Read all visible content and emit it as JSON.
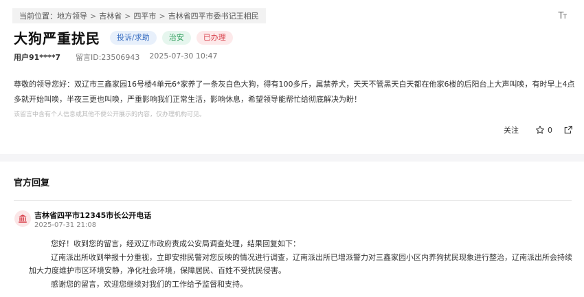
{
  "breadcrumb": {
    "prefix": "当前位置：",
    "items": [
      "地方领导",
      "吉林省",
      "四平市",
      "吉林省四平市委书记王相民"
    ],
    "separator": ">"
  },
  "font_button": {
    "big": "T",
    "small": "T"
  },
  "title": "大狗严重扰民",
  "tags": [
    "投诉/求助",
    "治安",
    "已办理"
  ],
  "meta": {
    "user": "用户91****7",
    "message_id": "留言ID:23506943",
    "time": "2025-07-30 10:47"
  },
  "content": "尊敬的领导您好：双辽市三鑫家园16号楼4单元6*家养了一条灰白色大狗，得有100多斤，属禁养犬，天天不管黑天白天都在他家6楼的后阳台上大声叫唤，有时早上4点多就开始叫唤，半夜三更也叫唤，严重影响我们正常生活，影响休息，希望领导能帮忙给彻底解决为盼！",
  "notice": "该留言中含有个人信息或其他不便公开展示的内容，仅办理机构可见。",
  "actions": {
    "follow": "关注",
    "star_count": "0"
  },
  "official": {
    "section_title": "官方回复",
    "org_name": "吉林省四平市12345市长公开电话",
    "time": "2025-07-31 21:08",
    "paragraphs": [
      "您好！收到您的留言，经双辽市政府责成公安局调查处理，结果回复如下：",
      "辽南派出所收到举报十分重视，立即安排民警对您反映的情况进行调查，辽南派出所已增派警力对三鑫家园小区内养狗扰民现象进行整治，辽南派出所会持续加大力度维护市区环境安静，净化社会环境，保障居民、百姓不受扰民侵害。",
      "感谢您的留言，欢迎您继续对我们的工作给予监督和支持。"
    ]
  },
  "colors": {
    "tag_blue": "#3a6fc2",
    "tag_green": "#2e9d5a",
    "tag_red": "#d8424c",
    "avatar_icon": "#d8424c"
  },
  "icons": [
    "font-size-icon",
    "star-icon",
    "share-icon",
    "government-building-icon"
  ]
}
